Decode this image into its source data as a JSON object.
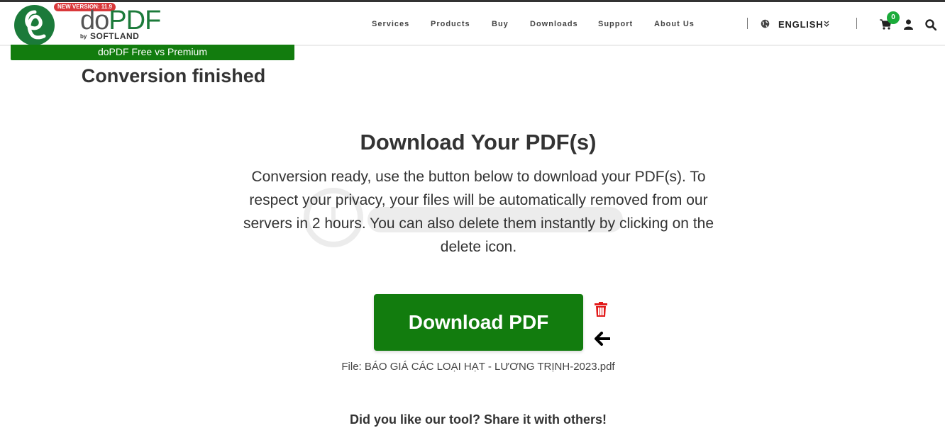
{
  "header": {
    "new_version_badge": "NEW VERSION: 11.9",
    "brand_do": "do",
    "brand_pdf": "PDF",
    "brand_by": "by",
    "brand_company": "SOFTLAND",
    "nav": [
      "Services",
      "Products",
      "Buy",
      "Downloads",
      "Support",
      "About Us"
    ],
    "language": "ENGLISH",
    "cart_count": "0",
    "icons": [
      "globe-icon",
      "chevron-double-down-icon",
      "cart-icon",
      "user-icon",
      "search-icon"
    ]
  },
  "promo_bar": "doPDF Free vs Premium",
  "status_heading": "Conversion finished",
  "main": {
    "title": "Download Your PDF(s)",
    "description": "Conversion ready, use the button below to download your PDF(s). To respect your privacy, your files will be automatically removed from our servers in 2 hours. You can also delete them instantly by clicking on the delete icon.",
    "download_button": "Download PDF",
    "file_label": "File: BÁO GIÁ CÁC LOẠI HẠT - LƯƠNG TRỊNH-2023.pdf",
    "share_prompt": "Did you like our tool? Share it with others!"
  },
  "colors": {
    "brand_green": "#127c0e",
    "logo_green": "#1b7a3a",
    "badge_red": "#d9383a",
    "trash_red": "#e21b1b",
    "cart_badge_green": "#1bab3a"
  }
}
